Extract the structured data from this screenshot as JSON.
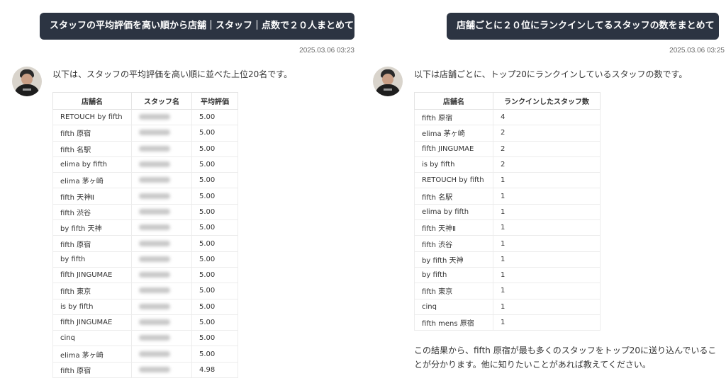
{
  "left": {
    "user_message": "スタッフの平均評価を高い順から店舗｜スタッフ｜点数で２０人まとめて",
    "timestamp": "2025.03.06 03:23",
    "intro": "以下は、スタッフの平均評価を高い順に並べた上位20名です。",
    "table": {
      "headers": [
        "店舗名",
        "スタッフ名",
        "平均評価"
      ],
      "rows": [
        [
          "RETOUCH by fifth",
          "",
          "5.00"
        ],
        [
          "fifth 原宿",
          "",
          "5.00"
        ],
        [
          "fifth 名駅",
          "",
          "5.00"
        ],
        [
          "elima by fifth",
          "",
          "5.00"
        ],
        [
          "elima 茅ヶ崎",
          "",
          "5.00"
        ],
        [
          "fifth 天神Ⅱ",
          "",
          "5.00"
        ],
        [
          "fifth 渋谷",
          "",
          "5.00"
        ],
        [
          "by fifth 天神",
          "",
          "5.00"
        ],
        [
          "fifth 原宿",
          "",
          "5.00"
        ],
        [
          "by fifth",
          "",
          "5.00"
        ],
        [
          "fifth JINGUMAE",
          "",
          "5.00"
        ],
        [
          "fifth 東京",
          "",
          "5.00"
        ],
        [
          "is by fifth",
          "",
          "5.00"
        ],
        [
          "fifth JINGUMAE",
          "",
          "5.00"
        ],
        [
          "cinq",
          "",
          "5.00"
        ],
        [
          "elima 茅ヶ崎",
          "",
          "5.00"
        ],
        [
          "fifth 原宿",
          "",
          "4.98"
        ]
      ]
    }
  },
  "right": {
    "user_message": "店舗ごとに２０位にランクインしてるスタッフの数をまとめて",
    "timestamp": "2025.03.06 03:25",
    "intro": "以下は店舗ごとに、トップ20にランクインしているスタッフの数です。",
    "table": {
      "headers": [
        "店舗名",
        "ランクインしたスタッフ数"
      ],
      "rows": [
        [
          "fifth 原宿",
          "4"
        ],
        [
          "elima 茅ヶ崎",
          "2"
        ],
        [
          "fifth JINGUMAE",
          "2"
        ],
        [
          "is by fifth",
          "2"
        ],
        [
          "RETOUCH by fifth",
          "1"
        ],
        [
          "fifth 名駅",
          "1"
        ],
        [
          "elima by fifth",
          "1"
        ],
        [
          "fifth 天神Ⅱ",
          "1"
        ],
        [
          "fifth 渋谷",
          "1"
        ],
        [
          "by fifth 天神",
          "1"
        ],
        [
          "by fifth",
          "1"
        ],
        [
          "fifth 東京",
          "1"
        ],
        [
          "cinq",
          "1"
        ],
        [
          "fifth mens 原宿",
          "1"
        ]
      ]
    },
    "conclusion": "この結果から、fifth 原宿が最も多くのスタッフをトップ20に送り込んでいることが分かります。他に知りたいことがあれば教えてください。"
  },
  "icons": {
    "avatar": "user-avatar"
  }
}
